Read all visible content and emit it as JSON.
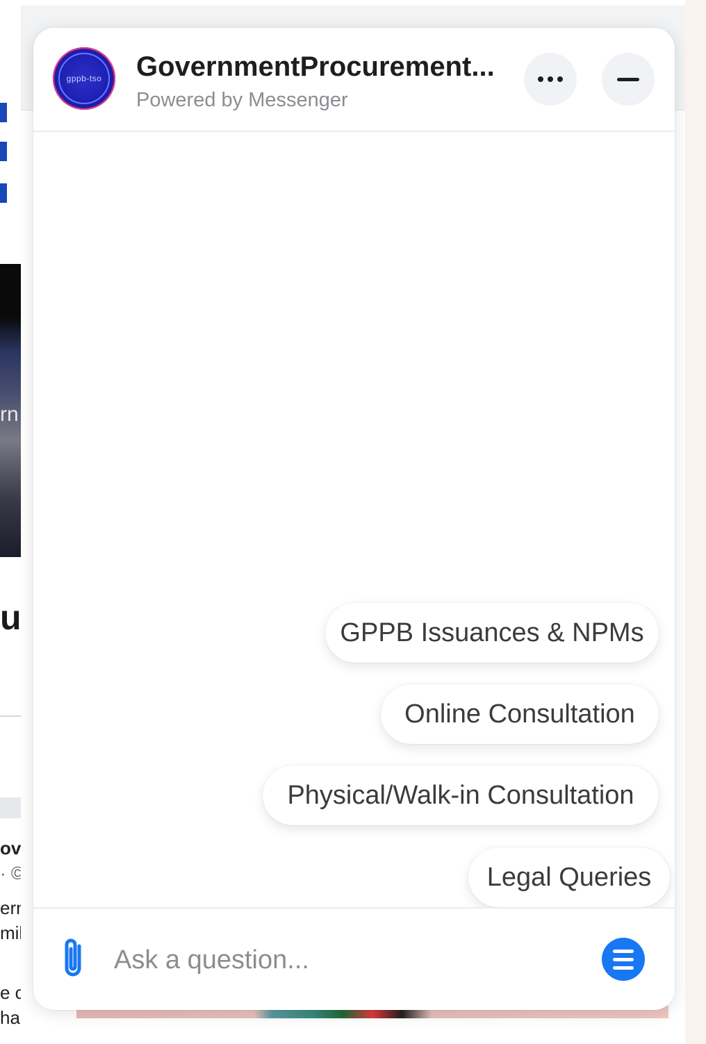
{
  "background": {
    "fragments": {
      "frag_rn": "rn",
      "frag_ur": "ur",
      "frag_ove": "ove",
      "frag_dot": "· ©",
      "frag_ern": "ern",
      "frag_mil": "mil",
      "frag_ec": "e c",
      "frag_ha": "ha"
    }
  },
  "header": {
    "title": "GovernmentProcurement...",
    "subtitle": "Powered by Messenger",
    "avatar_text": "gppb-tso",
    "more_icon": "more-horizontal-icon",
    "minimize_icon": "minimize-icon"
  },
  "quick_replies": [
    {
      "label": "GPPB Issuances & NPMs"
    },
    {
      "label": "Online Consultation"
    },
    {
      "label": "Physical/Walk-in Consultation"
    },
    {
      "label": "Legal Queries"
    }
  ],
  "composer": {
    "placeholder": "Ask a question...",
    "attach_icon": "paperclip-icon",
    "menu_icon": "menu-icon"
  },
  "colors": {
    "accent": "#1877f2",
    "avatar_bg": "#1b1fb0",
    "text_primary": "#1c1e21",
    "text_secondary": "#8a8d91"
  }
}
